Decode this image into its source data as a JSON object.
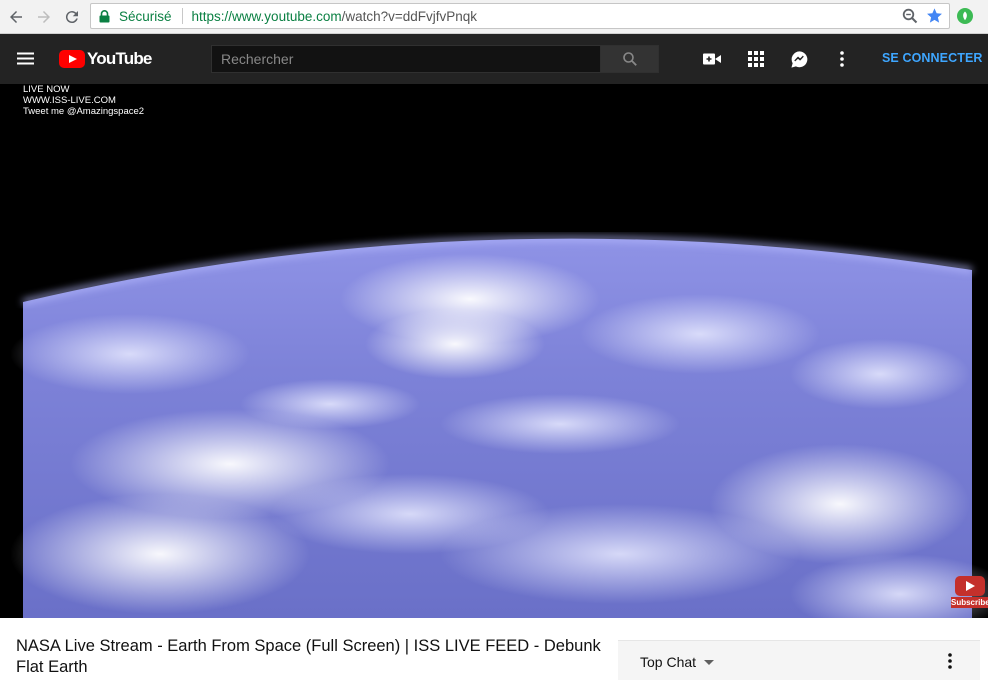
{
  "browser": {
    "secure_label": "Sécurisé",
    "url_host": "https://www.youtube.com",
    "url_path": "/watch?v=ddFvjfvPnqk"
  },
  "header": {
    "logo_text": "YouTube",
    "search_placeholder": "Rechercher",
    "signin_label": "SE CONNECTER"
  },
  "video": {
    "overlay_lines": [
      "LIVE NOW",
      "WWW.ISS-LIVE.COM",
      "Tweet me @Amazingspace2"
    ],
    "subscribe_label": "Subscribe"
  },
  "watch": {
    "title": "NASA Live Stream - Earth From Space (Full Screen) | ISS LIVE FEED - Debunk Flat Earth",
    "chat_mode": "Top Chat"
  },
  "colors": {
    "secure_green": "#0b8043",
    "brand_red": "#ff0000",
    "signin_blue": "#3ea6ff",
    "header_bg": "#232323"
  }
}
